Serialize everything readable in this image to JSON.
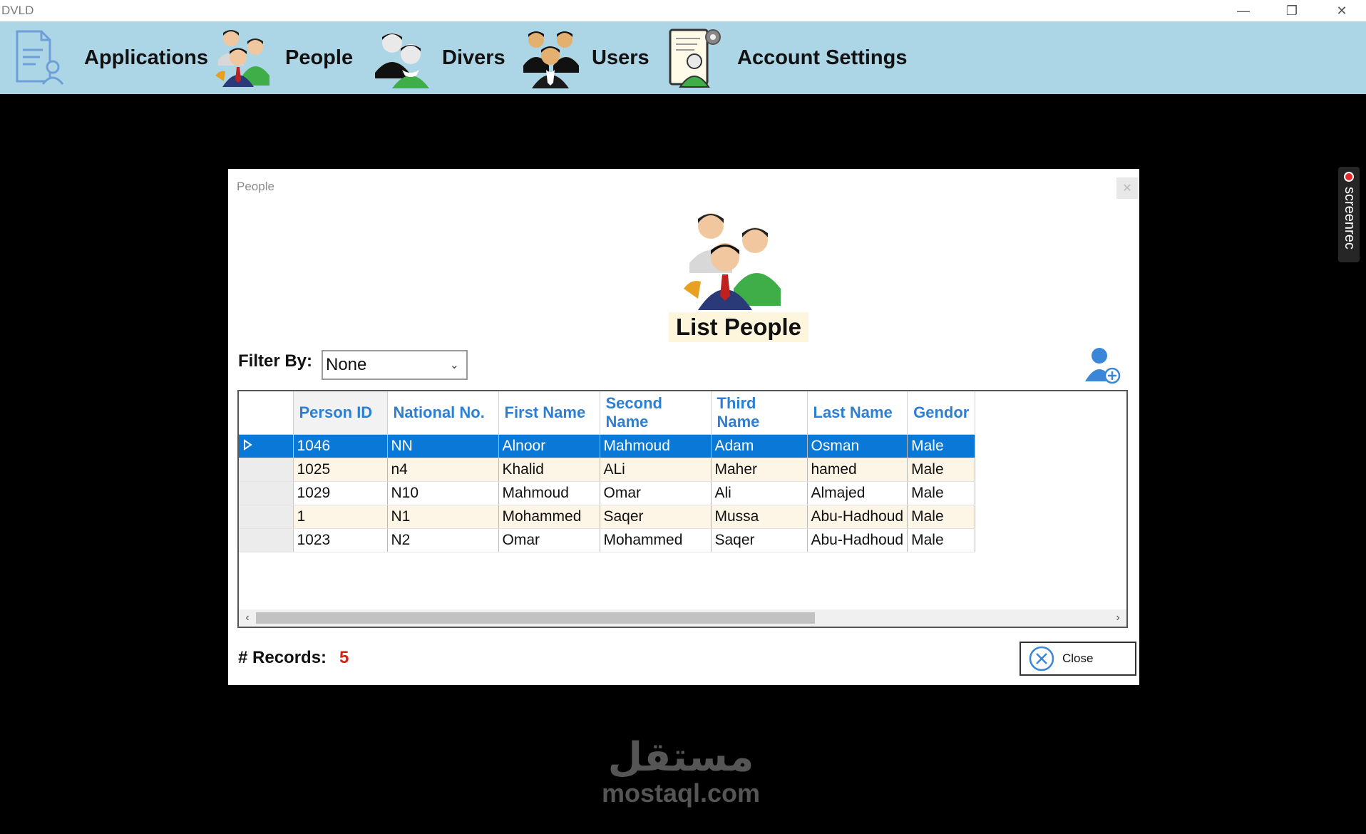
{
  "app": {
    "title": "DVLD"
  },
  "window_controls": {
    "minimize": "—",
    "maximize": "❐",
    "close": "✕"
  },
  "menu": {
    "items": [
      {
        "label": "Applications",
        "icon": "document-user-icon"
      },
      {
        "label": "People",
        "icon": "people-group-icon"
      },
      {
        "label": "Divers",
        "icon": "drivers-pair-icon"
      },
      {
        "label": "Users",
        "icon": "users-group-icon"
      },
      {
        "label": "Account Settings",
        "icon": "account-settings-icon"
      }
    ]
  },
  "dialog": {
    "title": "People",
    "close_glyph": "✕",
    "heading": "List People",
    "filter": {
      "label": "Filter By:",
      "value": "None"
    },
    "grid": {
      "columns": [
        "Person ID",
        "National No.",
        "First Name",
        "Second Name",
        "Third Name",
        "Last Name",
        "Gendor"
      ],
      "rows": [
        [
          "1046",
          "NN",
          "Alnoor",
          "Mahmoud",
          "Adam",
          "Osman",
          "Male"
        ],
        [
          "1025",
          "n4",
          "Khalid",
          "ALi",
          "Maher",
          "hamed",
          "Male"
        ],
        [
          "1029",
          "N10",
          "Mahmoud",
          "Omar",
          "Ali",
          "Almajed",
          "Male"
        ],
        [
          "1",
          "N1",
          "Mohammed",
          "Saqer",
          "Mussa",
          "Abu-Hadhoud",
          "Male"
        ],
        [
          "1023",
          "N2",
          "Omar",
          "Mohammed",
          "Saqer",
          "Abu-Hadhoud",
          "Male"
        ]
      ],
      "selected_row": 0
    },
    "records": {
      "label": "# Records:",
      "value": "5"
    },
    "close_button": {
      "label": "Close"
    }
  },
  "recorder": {
    "label": "screenrec"
  },
  "watermark": {
    "arabic": "مستقل",
    "latin": "mostaql.com"
  },
  "colors": {
    "menu_bg": "#acd6e6",
    "header_text": "#2d7fd3",
    "selection": "#0a78d7",
    "alt_row": "#fdf5e6",
    "records_value": "#e02010"
  }
}
